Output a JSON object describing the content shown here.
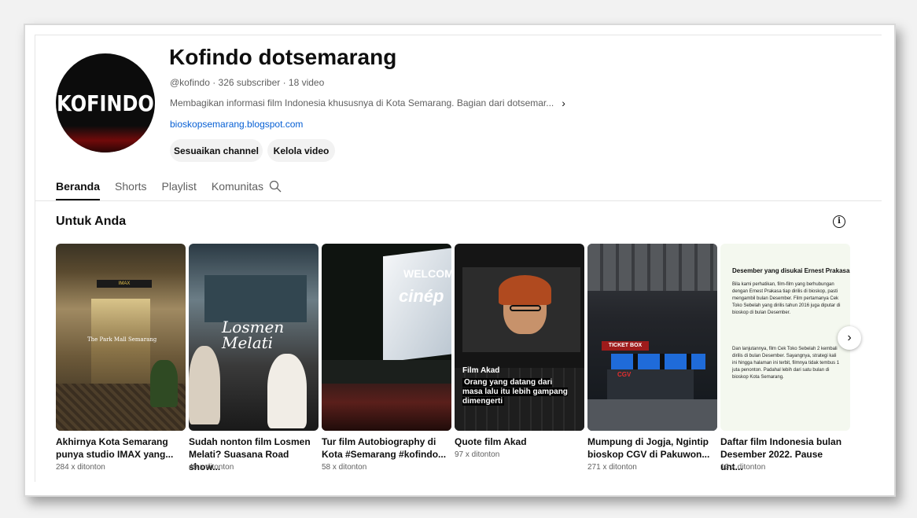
{
  "channel": {
    "avatar_logo": "KOFINDO",
    "name": "Kofindo dotsemarang",
    "meta": "@kofindo · 326 subscriber · 18 video",
    "description": "Membagikan informasi film Indonesia khususnya di Kota Semarang. Bagian dari dotsemar...",
    "link": "bioskopsemarang.blogspot.com",
    "buttons": {
      "customize": "Sesuaikan channel",
      "manage": "Kelola video"
    }
  },
  "tabs": [
    {
      "label": "Beranda",
      "active": true
    },
    {
      "label": "Shorts",
      "active": false
    },
    {
      "label": "Playlist",
      "active": false
    },
    {
      "label": "Komunitas",
      "active": false
    }
  ],
  "section": {
    "title": "Untuk Anda"
  },
  "videos": [
    {
      "title": "Akhirnya Kota Semarang punya studio IMAX yang...",
      "views": "284 x ditonton",
      "thumb_text": "The Park Mall Semarang"
    },
    {
      "title": "Sudah nonton film Losmen Melati? Suasana Road show...",
      "views": "45 x ditonton",
      "thumb_text": "Losmen Melati"
    },
    {
      "title": "Tur film Autobiography di Kota #Semarang #kofindo...",
      "views": "58 x ditonton",
      "thumb_text_1": "WELCOM",
      "thumb_text_2": "cinép"
    },
    {
      "title": "Quote film Akad",
      "views": "97 x ditonton",
      "thumb_caption_1": "Film Akad",
      "thumb_caption_2": "Orang yang datang dari masa lalu itu lebih gampang dimengerti"
    },
    {
      "title": "Mumpung di Jogja, Ngintip bioskop CGV di Pakuwon...",
      "views": "271 x ditonton",
      "thumb_text_1": "TICKET BOX",
      "thumb_text_2": "CGV"
    },
    {
      "title": "Daftar film Indonesia bulan Desember 2022. Pause unt...",
      "views": "13 x ditonton",
      "thumb_heading": "Desember yang disukai Ernest Prakasa",
      "thumb_para_1": "Bila kami perhatikan, film-film yang berhubungan dengan Ernest Prakasa tiap dirilis di bioskop, pasti mengambil bulan Desember. Film pertamanya Cek Toko Sebelah yang dirilis tahun 2016 juga diputar di bioskop di bulan Desember.",
      "thumb_para_2": "Dan lanjutannya, film Cek Toko Sebelah 2 kembali dirilis di bulan Desember. Sayangnya, strategi kali ini hingga halaman ini terbit, filmnya tidak tembus 1 juta penonton. Padahal lebih dari satu bulan di bioskop Kota Semarang."
    }
  ]
}
